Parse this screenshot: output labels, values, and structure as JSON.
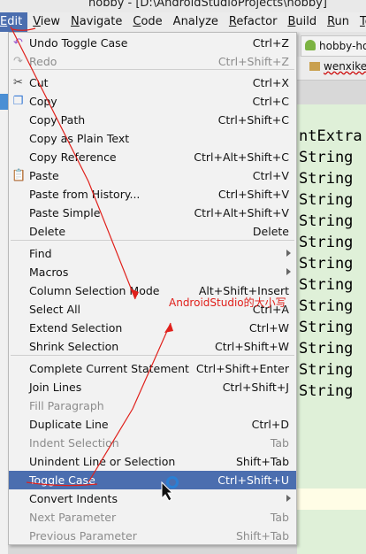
{
  "title_bar": {
    "text": "hobby - [D:\\AndroidStudioProjects\\hobby]"
  },
  "menubar": {
    "items": [
      {
        "label": "Edit",
        "mnemonic": "E",
        "rest": "dit",
        "active": true
      },
      {
        "label": "View",
        "mnemonic": "V",
        "rest": "iew"
      },
      {
        "label": "Navigate",
        "mnemonic": "N",
        "rest": "avigate"
      },
      {
        "label": "Code",
        "mnemonic": "C",
        "rest": "ode"
      },
      {
        "label": "Analyze",
        "mnemonic": "",
        "rest": "Analyze"
      },
      {
        "label": "Refactor",
        "mnemonic": "R",
        "rest": "efactor"
      },
      {
        "label": "Build",
        "mnemonic": "B",
        "rest": "uild"
      },
      {
        "label": "Run",
        "mnemonic": "R",
        "rest": "un"
      },
      {
        "label": "Too",
        "mnemonic": "T",
        "rest": "oo"
      }
    ]
  },
  "editor_tab": {
    "label": "hobby-ho"
  },
  "breadcrumb": {
    "label": "wenxike"
  },
  "editor_lines": [
    "ntExtra",
    "String",
    "String",
    "String",
    "String",
    "String",
    "String",
    "String",
    "String",
    "String",
    "String",
    "String",
    "String"
  ],
  "edit_menu": {
    "groups": [
      [
        {
          "label": "Undo Toggle Case",
          "shortcut": "Ctrl+Z",
          "icon": "undo-icon",
          "glyph": "↶",
          "color": "#9b59d0"
        },
        {
          "label": "Redo",
          "shortcut": "Ctrl+Shift+Z",
          "icon": "redo-icon",
          "glyph": "↷",
          "color": "#aaaaaa",
          "disabled": true
        }
      ],
      [
        {
          "label": "Cut",
          "shortcut": "Ctrl+X",
          "icon": "scissors-icon",
          "glyph": "✂",
          "color": "#444444"
        },
        {
          "label": "Copy",
          "shortcut": "Ctrl+C",
          "icon": "copy-icon",
          "glyph": "❐",
          "color": "#3a7bd5"
        },
        {
          "label": "Copy Path",
          "shortcut": "Ctrl+Shift+C"
        },
        {
          "label": "Copy as Plain Text",
          "shortcut": ""
        },
        {
          "label": "Copy Reference",
          "shortcut": "Ctrl+Alt+Shift+C"
        },
        {
          "label": "Paste",
          "shortcut": "Ctrl+V",
          "icon": "paste-icon",
          "glyph": "📋",
          "color": "#7a5a2a"
        },
        {
          "label": "Paste from History...",
          "shortcut": "Ctrl+Shift+V"
        },
        {
          "label": "Paste Simple",
          "shortcut": "Ctrl+Alt+Shift+V"
        },
        {
          "label": "Delete",
          "shortcut": "Delete"
        }
      ],
      [
        {
          "label": "Find",
          "shortcut": "",
          "submenu": true
        },
        {
          "label": "Macros",
          "shortcut": "",
          "submenu": true
        },
        {
          "label": "Column Selection Mode",
          "shortcut": "Alt+Shift+Insert"
        },
        {
          "label": "Select All",
          "shortcut": "Ctrl+A"
        },
        {
          "label": "Extend Selection",
          "shortcut": "Ctrl+W"
        },
        {
          "label": "Shrink Selection",
          "shortcut": "Ctrl+Shift+W"
        }
      ],
      [
        {
          "label": "Complete Current Statement",
          "shortcut": "Ctrl+Shift+Enter"
        },
        {
          "label": "Join Lines",
          "shortcut": "Ctrl+Shift+J"
        },
        {
          "label": "Fill Paragraph",
          "shortcut": "",
          "disabled": true
        },
        {
          "label": "Duplicate Line",
          "shortcut": "Ctrl+D"
        },
        {
          "label": "Indent Selection",
          "shortcut": "Tab",
          "disabled": true
        },
        {
          "label": "Unindent Line or Selection",
          "shortcut": "Shift+Tab"
        },
        {
          "label": "Toggle Case",
          "shortcut": "Ctrl+Shift+U",
          "selected": true
        },
        {
          "label": "Convert Indents",
          "shortcut": "",
          "submenu": true
        },
        {
          "label": "Next Parameter",
          "shortcut": "Tab",
          "disabled": true
        },
        {
          "label": "Previous Parameter",
          "shortcut": "Shift+Tab",
          "disabled": true
        }
      ]
    ]
  },
  "annotation": {
    "text": "AndroidStudio的大小写",
    "color": "#e0201b"
  },
  "colors": {
    "menu_selected": "#4b6eaf",
    "editor_bg": "#dff0d8",
    "annotation": "#e0201b"
  }
}
